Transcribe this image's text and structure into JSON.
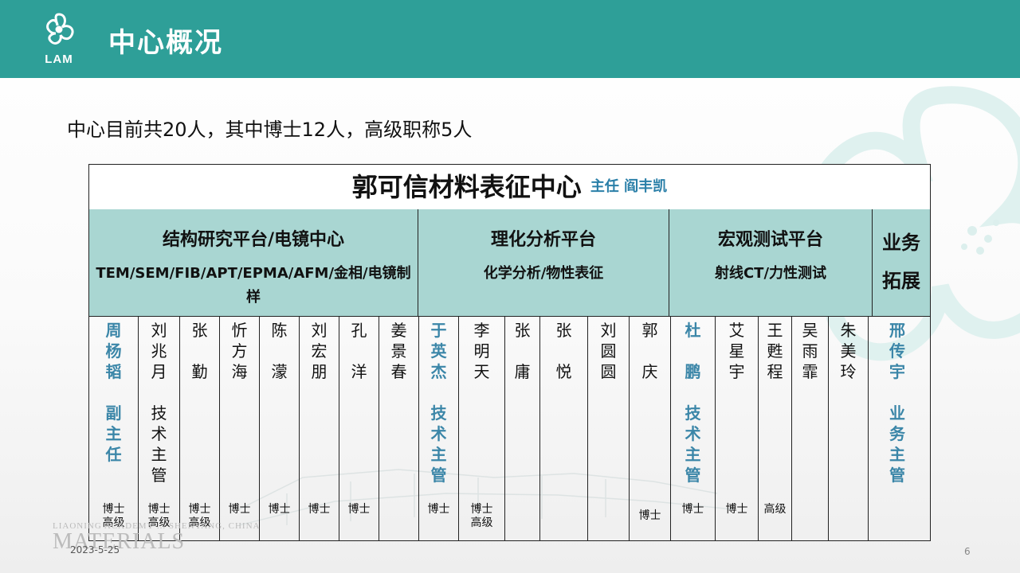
{
  "header": {
    "title": "中心概况",
    "logo_text": "LAM"
  },
  "summary": "中心目前共20人，其中博士12人，高级职称5人",
  "center": {
    "name": "郭可信材料表征中心",
    "director": "主任 阎丰凯"
  },
  "platforms": [
    {
      "name": "结构研究平台/电镜中心",
      "desc": "TEM/SEM/FIB/APT/EPMA/AFM/金相/电镜制样"
    },
    {
      "name": "理化分析平台",
      "desc": "化学分析/物性表征"
    },
    {
      "name": "宏观测试平台",
      "desc": "射线CT/力性测试"
    },
    {
      "name": "业务拓展",
      "desc": ""
    }
  ],
  "members": [
    {
      "name": "周\n杨\n韬",
      "role": "副\n主\n任",
      "degree": "博士\n高级"
    },
    {
      "name": "刘\n兆\n月",
      "role": "技\n术\n主\n管",
      "degree": "博士\n高级"
    },
    {
      "name": "张\n\n勤",
      "role": "",
      "degree": "博士\n高级"
    },
    {
      "name": "忻\n方\n海",
      "role": "",
      "degree": "博士"
    },
    {
      "name": "陈\n\n濛",
      "role": "",
      "degree": "博士"
    },
    {
      "name": "刘\n宏\n朋",
      "role": "",
      "degree": "博士"
    },
    {
      "name": "孔\n\n洋",
      "role": "",
      "degree": "博士"
    },
    {
      "name": "姜\n景\n春",
      "role": "",
      "degree": ""
    },
    {
      "name": "于\n英\n杰",
      "role": "技\n术\n主\n管",
      "degree": "博士"
    },
    {
      "name": "李\n明\n天",
      "role": "",
      "degree": "博士\n高级"
    },
    {
      "name": "张\n\n庸",
      "role": "",
      "degree": ""
    },
    {
      "name": "张\n\n悦",
      "role": "",
      "degree": ""
    },
    {
      "name": "刘\n圆\n圆",
      "role": "",
      "degree": ""
    },
    {
      "name": "郭\n\n庆",
      "role": "",
      "degree": "博士"
    },
    {
      "name": "杜\n\n鹏",
      "role": "技\n术\n主\n管",
      "degree": "博士"
    },
    {
      "name": "艾\n星\n宇",
      "role": "",
      "degree": "博士"
    },
    {
      "name": "王\n甦\n程",
      "role": "",
      "degree": "高级"
    },
    {
      "name": "吴\n雨\n霏",
      "role": "",
      "degree": ""
    },
    {
      "name": "朱\n美\n玲",
      "role": "",
      "degree": ""
    },
    {
      "name": "邢\n传\n宇",
      "role": "业\n务\n主\n管",
      "degree": ""
    }
  ],
  "footer": {
    "date": "2023-5-25",
    "page": "6",
    "brand_small": "LIAONING ACADEMY ... SHENYANG, CHINA",
    "brand_large": "MATERIALS"
  },
  "colors": {
    "header_bg": "#2e9f98",
    "platform_bg": "#a9d6d2",
    "highlight": "#3b86a8"
  }
}
